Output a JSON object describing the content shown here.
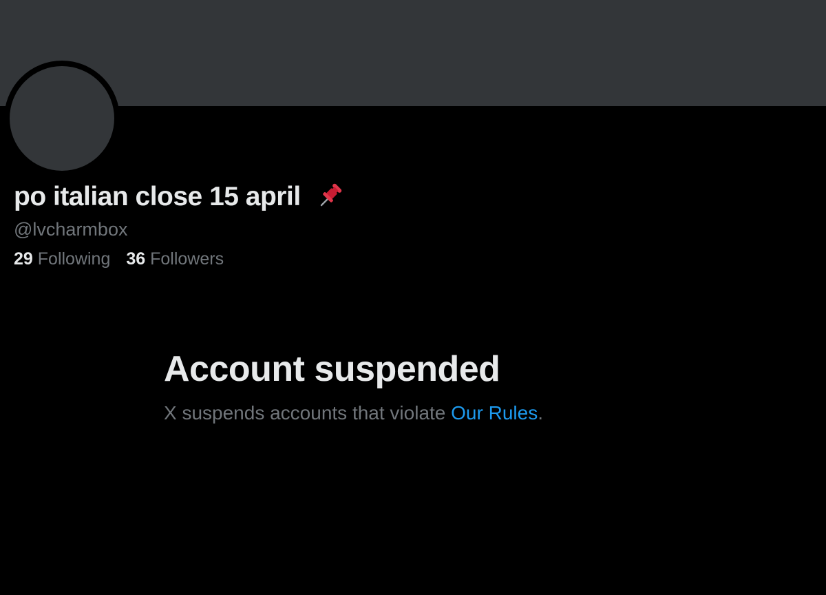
{
  "profile": {
    "display_name": "po italian close 15 april",
    "display_name_icon": "pushpin-icon",
    "handle": "@lvcharmbox",
    "following_count": "29",
    "following_label": "Following",
    "followers_count": "36",
    "followers_label": "Followers"
  },
  "suspension": {
    "title": "Account suspended",
    "message": "X suspends accounts that violate ",
    "link_text": "Our Rules",
    "trailing": "."
  },
  "colors": {
    "background": "#000000",
    "banner": "#333639",
    "primary_text": "#e7e9ea",
    "secondary_text": "#71767b",
    "link": "#1d9bf0",
    "pin": "#d6263b"
  }
}
